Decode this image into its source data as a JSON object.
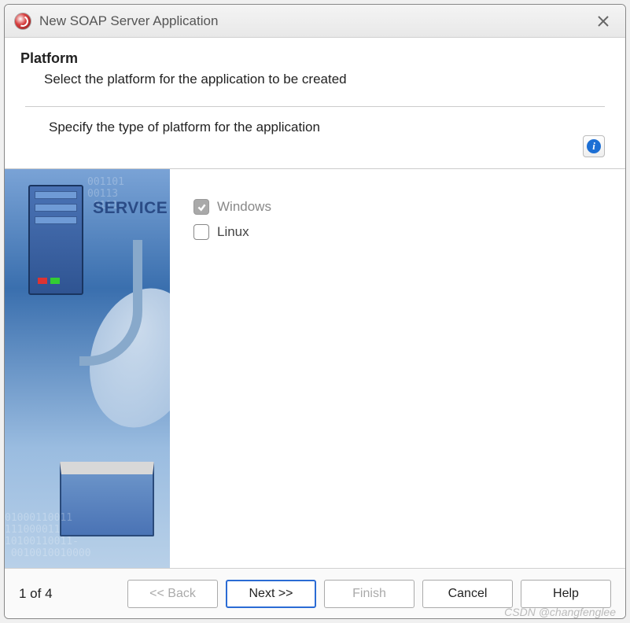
{
  "window": {
    "title": "New SOAP Server Application"
  },
  "header": {
    "title": "Platform",
    "description": "Select the platform for the application to be created"
  },
  "instruction": "Specify the type of platform for the application",
  "info_icon_label": "i",
  "sidebar_graphic": {
    "service_label": "SERVICE",
    "binary_top": "001101\n00113\n 0111",
    "binary_bottom": "01000110011\n111000011\n10100110011-\n 0010010010000"
  },
  "options": {
    "windows": {
      "label": "Windows",
      "checked": true,
      "disabled": true
    },
    "linux": {
      "label": "Linux",
      "checked": false,
      "disabled": false
    }
  },
  "footer": {
    "step": "1 of 4",
    "back": "<< Back",
    "next": "Next >>",
    "finish": "Finish",
    "cancel": "Cancel",
    "help": "Help"
  },
  "watermark": "CSDN @changfenglee"
}
